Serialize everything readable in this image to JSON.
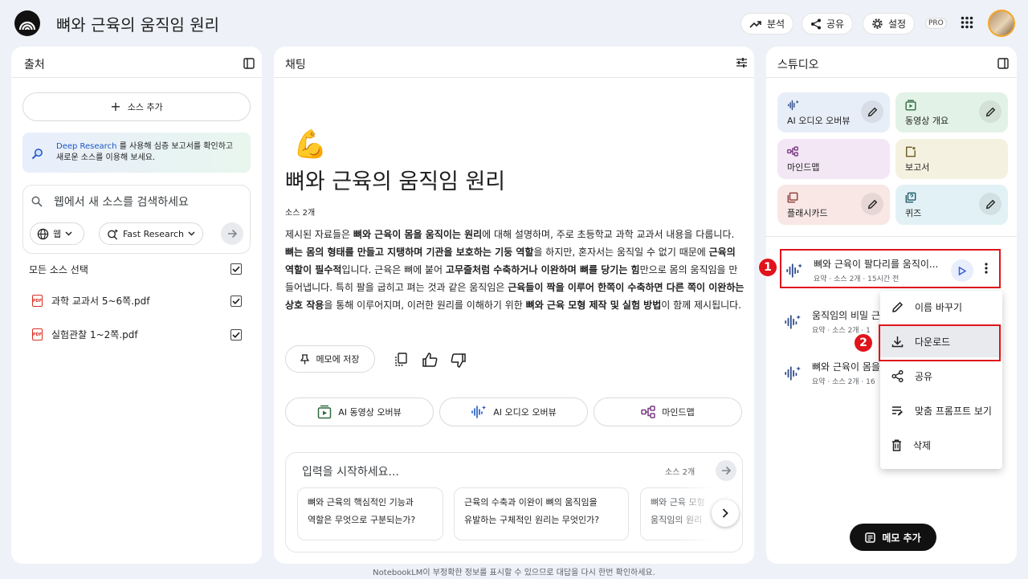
{
  "topbar": {
    "title": "뼈와 근육의 움직임 원리",
    "analyze_label": "분석",
    "share_label": "공유",
    "settings_label": "설정",
    "pro_label": "PRO"
  },
  "sources": {
    "title": "출처",
    "add_label": "소스 추가",
    "deep_research_link": "Deep Research",
    "deep_research_text1": "를 사용해 심층 보고서를 확인하고",
    "deep_research_text2": "새로운 소스를 이용해 보세요.",
    "search_placeholder": "웹에서 새 소스를 검색하세요",
    "web_label": "웹",
    "fast_research_label": "Fast Research",
    "select_all_label": "모든 소스 선택",
    "files": [
      {
        "name": "과학 교과서 5~6쪽.pdf",
        "checked": true
      },
      {
        "name": "실험관찰 1~2쪽.pdf",
        "checked": true
      }
    ]
  },
  "chat": {
    "title": "채팅",
    "emoji": "💪",
    "heading": "뼈와 근육의 움직임 원리",
    "source_count": "소스 2개",
    "summary": [
      {
        "t": "제시된 자료들은 "
      },
      {
        "b": "뼈와 근육이 몸을 움직이는 원리"
      },
      {
        "t": "에 대해 설명하며, 주로 초등학교 과학 교과서 내용을 다룹니다. "
      },
      {
        "b": "뼈는 몸의 형태를 만들고 지탱하며 기관을 보호하는 기둥 역할"
      },
      {
        "t": "을 하지만, 혼자서는 움직일 수 없기 때문에 "
      },
      {
        "b": "근육의 역할이 필수적"
      },
      {
        "t": "입니다. 근육은 뼈에 붙어 "
      },
      {
        "b": "고무줄처럼 수축하거나 이완하며 뼈를 당기는 힘"
      },
      {
        "t": "만으로 몸의 움직임을 만들어냅니다. 특히 팔을 굽히고 펴는 것과 같은 움직임은 "
      },
      {
        "b": "근육들이 짝을 이루어 한쪽이 수축하면 다른 쪽이 이완하는 상호 작용"
      },
      {
        "t": "을 통해 이루어지며, 이러한 원리를 이해하기 위한 "
      },
      {
        "b": "뼈와 근육 모형 제작 및 실험 방법"
      },
      {
        "t": "이 함께 제시됩니다."
      }
    ],
    "save_note_label": "메모에 저장",
    "chips": [
      "AI 동영상 오버뷰",
      "AI 오디오 오버뷰",
      "마인드맵"
    ],
    "input_placeholder": "입력을 시작하세요...",
    "input_source_count": "소스 2개",
    "suggestions": [
      [
        "뼈와 근육의 핵심적인 기능과",
        "역할은 무엇으로 구분되는가?"
      ],
      [
        "근육의 수축과 이완이 뼈의 움직임을",
        "유발하는 구체적인 원리는 무엇인가?"
      ],
      [
        "뼈와 근육 모형",
        "움직임의 원리"
      ]
    ]
  },
  "studio": {
    "title": "스튜디오",
    "tiles": [
      {
        "label": "AI 오디오 오버뷰",
        "color": "#e8eef8",
        "icon_color": "#2d4a8a",
        "icon": "audio-icon",
        "editable": true
      },
      {
        "label": "동영상 개요",
        "color": "#e3f2e7",
        "icon_color": "#2e6b3f",
        "icon": "video-icon",
        "editable": true
      },
      {
        "label": "마인드맵",
        "color": "#f3e7f5",
        "icon_color": "#7a3b84",
        "icon": "mindmap-icon",
        "editable": false
      },
      {
        "label": "보고서",
        "color": "#f5f1e0",
        "icon_color": "#6b5a1e",
        "icon": "report-icon",
        "editable": false
      },
      {
        "label": "플래시카드",
        "color": "#f8e7e5",
        "icon_color": "#8a3a32",
        "icon": "flashcard-icon",
        "editable": true
      },
      {
        "label": "퀴즈",
        "color": "#e2f1f5",
        "icon_color": "#1e5b6b",
        "icon": "quiz-icon",
        "editable": true
      }
    ],
    "notes": [
      {
        "title": "뼈와 근육이 팔다리를 움직이...",
        "meta": "요약 · 소스 2개 · 15시간 전"
      },
      {
        "title": "움직임의 비밀 근",
        "meta": "요약 · 소스 2개 · 1"
      },
      {
        "title": "뼈와 근육이 몸을",
        "meta": "요약 · 소스 2개 · 16"
      }
    ],
    "add_note_label": "메모 추가"
  },
  "context_menu": {
    "items": [
      {
        "label": "이름 바꾸기",
        "icon": "pencil-icon"
      },
      {
        "label": "다운로드",
        "icon": "download-icon"
      },
      {
        "label": "공유",
        "icon": "share-icon"
      },
      {
        "label": "맞춤 프롬프트 보기",
        "icon": "prompt-icon"
      },
      {
        "label": "삭제",
        "icon": "trash-icon"
      }
    ]
  },
  "annotations": {
    "badge1": "1",
    "badge2": "2"
  },
  "footer": {
    "disclaimer": "NotebookLM이 부정확한 정보를 표시할 수 있으므로 대답을 다시 한번 확인하세요."
  },
  "colors": {
    "accent_red": "#e0141b",
    "link_blue": "#1a56c4",
    "play_blue": "#3b5bdb"
  }
}
